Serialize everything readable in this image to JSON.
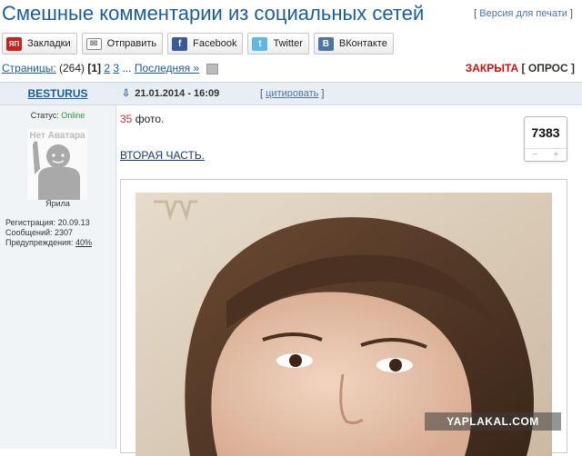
{
  "topic": {
    "title": "Смешные комментарии из социальных сетей",
    "print_version": "Версия для печати"
  },
  "share": [
    {
      "label": "Закладки",
      "icon": "yaplakal-icon"
    },
    {
      "label": "Отправить",
      "icon": "mail-icon"
    },
    {
      "label": "Facebook",
      "icon": "facebook-icon"
    },
    {
      "label": "Twitter",
      "icon": "twitter-icon"
    },
    {
      "label": "ВКонтакте",
      "icon": "vk-icon"
    }
  ],
  "pagination": {
    "label": "Страницы:",
    "count": "(264)",
    "current": "[1]",
    "pages": [
      "2",
      "3"
    ],
    "ellipsis": "...",
    "last": "Последняя »"
  },
  "topic_status": {
    "closed": "ЗАКРЫТА",
    "poll": "[ ОПРОС ]"
  },
  "post": {
    "author": "BESTURUS",
    "date": "21.01.2014 - 16:09",
    "quote": "цитировать",
    "status_label": "Статус:",
    "status_value": "Online",
    "avatar_text": "Нет Аватара",
    "role": "Ярила",
    "registration": "Регистрация: 20.09.13",
    "messages": "Сообщений: 2307",
    "warnings_label": "Предупреждения:",
    "warnings_value": "40%",
    "photo_count": "35",
    "photo_word": " фото.",
    "part_link": "ВТОРАЯ ЧАСТЬ.",
    "rating": "7383",
    "rating_minus": "−",
    "rating_plus": "+",
    "watermark": "YAPLAKAL.COM"
  },
  "colors": {
    "title": "#1a5d9c",
    "closed": "#cc1010",
    "online": "#2b9a2b"
  }
}
